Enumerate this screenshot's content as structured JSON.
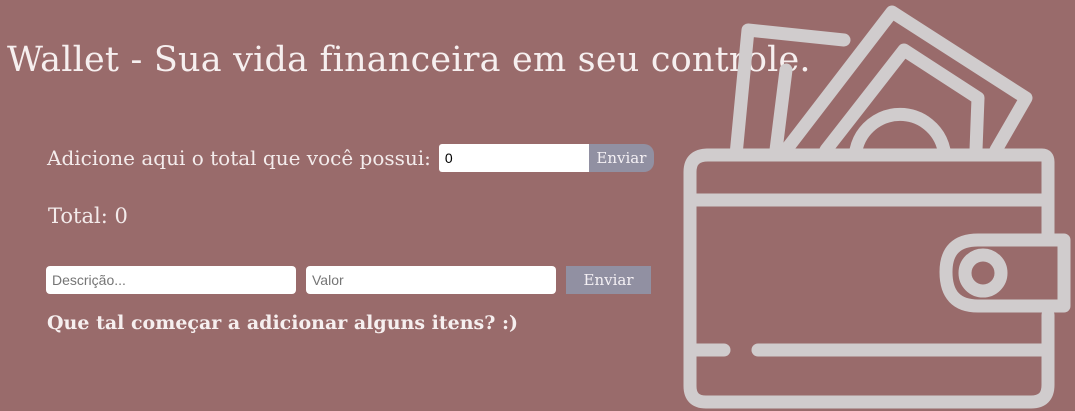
{
  "header": {
    "title": "Wallet - Sua vida financeira em seu controle."
  },
  "total_form": {
    "label": "Adicione aqui o total que você possui:",
    "input_value": "0",
    "submit_label": "Enviar"
  },
  "total_display": {
    "text": "Total: 0"
  },
  "item_form": {
    "description_placeholder": "Descrição...",
    "value_placeholder": "Valor",
    "submit_label": "Enviar"
  },
  "empty_state": {
    "message": "Que tal começar a adicionar alguns itens? :)"
  },
  "illustration": {
    "icon": "wallet-icon",
    "color": "#d0cccd"
  },
  "colors": {
    "background": "#996b6b",
    "button": "#9190a2",
    "text": "#f3ebeb"
  }
}
